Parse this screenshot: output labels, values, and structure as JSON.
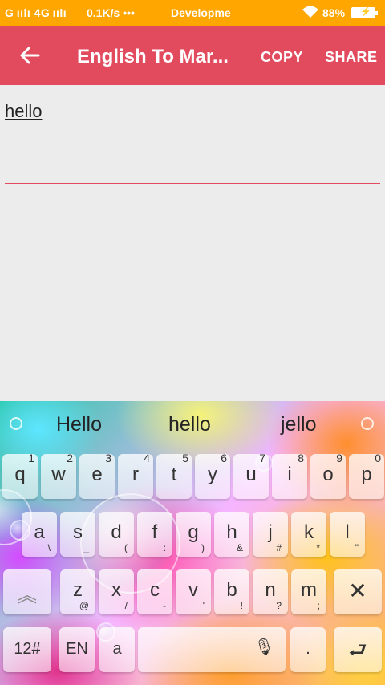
{
  "status_bar": {
    "signal": "G ıılı 4G ıılı",
    "speed": "0.1K/s •••",
    "carrier": "Developme",
    "battery": "88%",
    "bg": "#ffa600"
  },
  "app_bar": {
    "title": "English To Mar...",
    "copy": "COPY",
    "share": "SHARE",
    "bg": "#e24b5e"
  },
  "content": {
    "input_value": "hello"
  },
  "keyboard": {
    "suggestions": [
      "Hello",
      "hello",
      "jello"
    ],
    "row1": [
      {
        "k": "q",
        "n": "1"
      },
      {
        "k": "w",
        "n": "2"
      },
      {
        "k": "e",
        "n": "3"
      },
      {
        "k": "r",
        "n": "4"
      },
      {
        "k": "t",
        "n": "5"
      },
      {
        "k": "y",
        "n": "6"
      },
      {
        "k": "u",
        "n": "7"
      },
      {
        "k": "i",
        "n": "8"
      },
      {
        "k": "o",
        "n": "9"
      },
      {
        "k": "p",
        "n": "0"
      }
    ],
    "row2": [
      {
        "k": "a",
        "s": "\\"
      },
      {
        "k": "s",
        "s": "_"
      },
      {
        "k": "d",
        "s": "("
      },
      {
        "k": "f",
        "s": ":"
      },
      {
        "k": "g",
        "s": ")"
      },
      {
        "k": "h",
        "s": "&"
      },
      {
        "k": "j",
        "s": "#"
      },
      {
        "k": "k",
        "s": "*"
      },
      {
        "k": "l",
        "s": "\""
      }
    ],
    "row3": [
      {
        "k": "z",
        "s": "@"
      },
      {
        "k": "x",
        "s": "/"
      },
      {
        "k": "c",
        "s": "-"
      },
      {
        "k": "v",
        "s": "'"
      },
      {
        "k": "b",
        "s": "!"
      },
      {
        "k": "n",
        "s": "?"
      },
      {
        "k": "m",
        "s": ";"
      }
    ],
    "numbers_key": "12#",
    "lang_key": "EN",
    "comma_key": "a",
    "period_key": "."
  }
}
